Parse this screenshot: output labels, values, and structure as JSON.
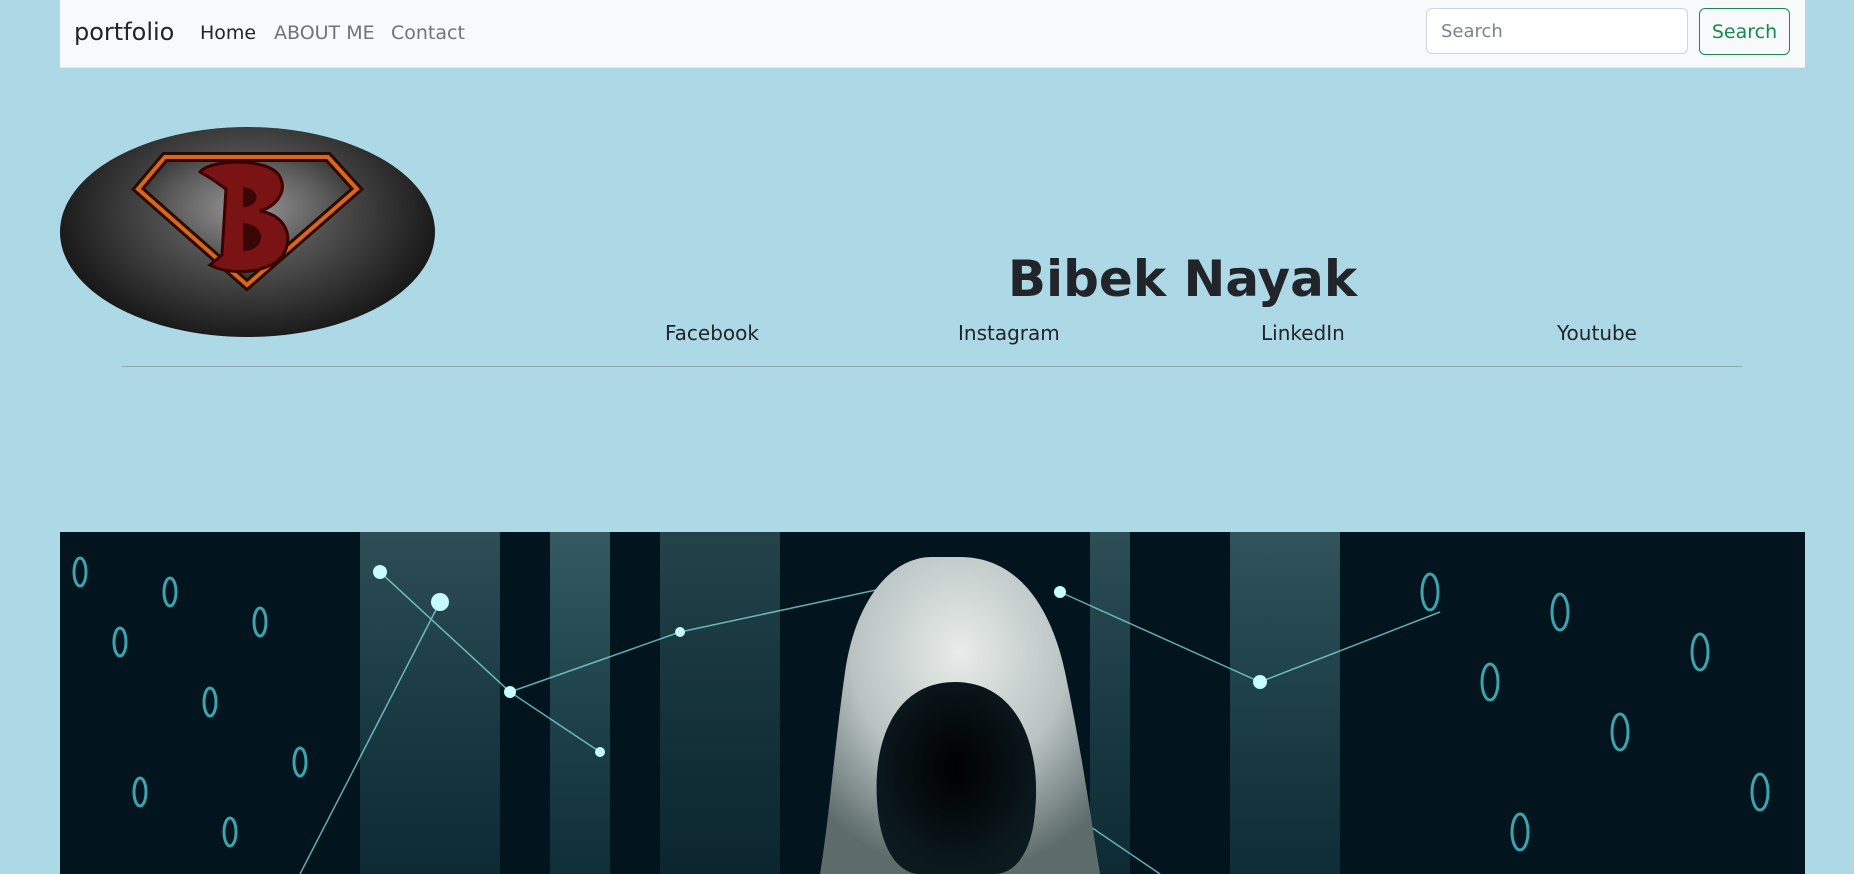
{
  "navbar": {
    "brand": "portfolio",
    "links": [
      "Home",
      "ABOUT ME",
      "Contact"
    ],
    "search": {
      "placeholder": "Search",
      "button_label": "Search"
    }
  },
  "header": {
    "title": "Bibek Nayak",
    "social_links": [
      "Facebook",
      "Instagram",
      "LinkedIn",
      "Youtube"
    ]
  },
  "logo": {
    "letter": "B"
  },
  "colors": {
    "background": "#add8e6",
    "navbar": "#f8f9fa",
    "search_button": "#198754",
    "hero_dark": "#02141d",
    "hero_glow": "#4fd6e0"
  }
}
